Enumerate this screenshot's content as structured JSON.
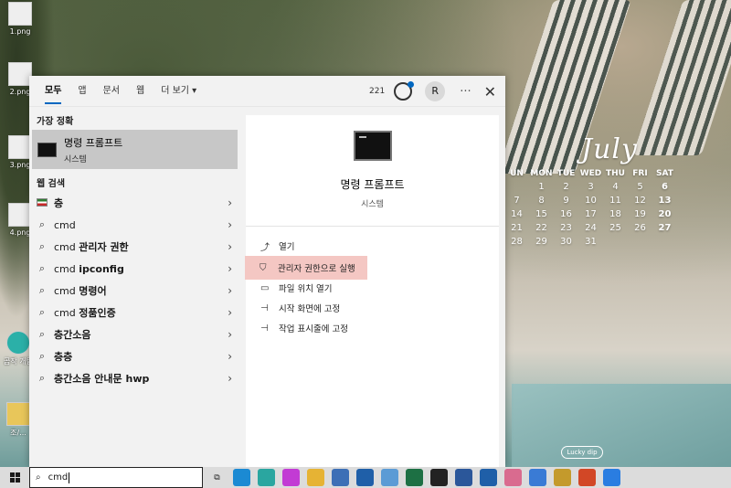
{
  "desktop": {
    "icons": [
      {
        "label": "1.png"
      },
      {
        "label": "2.png"
      },
      {
        "label": "3.png"
      },
      {
        "label": "4.png"
      },
      {
        "label": "곰작\n개팀"
      },
      {
        "label": "조/..."
      }
    ],
    "calendar": {
      "month": "July",
      "weekdays": [
        "SUN",
        "MON",
        "TUE",
        "WED",
        "THU",
        "FRI",
        "SAT"
      ],
      "days": [
        "",
        "",
        "1",
        "2",
        "3",
        "4",
        "5",
        "6",
        "7",
        "8",
        "9",
        "10",
        "11",
        "12",
        "13",
        "14",
        "15",
        "16",
        "17",
        "18",
        "19",
        "20",
        "21",
        "22",
        "23",
        "24",
        "25",
        "26",
        "27",
        "28",
        "29",
        "30",
        "31"
      ],
      "visible_weekdays": [
        "UN",
        "MON",
        "TUE",
        "WED",
        "THU",
        "FRI",
        "SAT"
      ],
      "rows": [
        [
          "",
          "1",
          "2",
          "3",
          "4",
          "5",
          "6"
        ],
        [
          "7",
          "8",
          "9",
          "10",
          "11",
          "12",
          "13"
        ],
        [
          "14",
          "15",
          "16",
          "17",
          "18",
          "19",
          "20"
        ],
        [
          "21",
          "22",
          "23",
          "24",
          "25",
          "26",
          "27"
        ],
        [
          "28",
          "29",
          "30",
          "31",
          "",
          "",
          ""
        ]
      ]
    },
    "badge": "Lucky dip"
  },
  "search": {
    "tabs": [
      {
        "label": "모두",
        "active": true
      },
      {
        "label": "앱"
      },
      {
        "label": "문서"
      },
      {
        "label": "웹"
      },
      {
        "label": "더 보기 ▾"
      }
    ],
    "points": "221",
    "avatar_initial": "R",
    "more": "···",
    "close": "✕",
    "best_match_label": "가장 정확",
    "best_match": {
      "title": "명령 프롬프트",
      "subtitle": "시스템"
    },
    "web_label": "웹 검색",
    "results": [
      {
        "pre": "",
        "bold": "층",
        "icon": "word-icon"
      },
      {
        "pre": "cmd",
        "bold": "",
        "icon": "search-icon"
      },
      {
        "pre": "cmd ",
        "bold": "관리자 권한",
        "icon": "search-icon"
      },
      {
        "pre": "cmd ",
        "bold": "ipconfig",
        "icon": "search-icon"
      },
      {
        "pre": "cmd ",
        "bold": "명령어",
        "icon": "search-icon"
      },
      {
        "pre": "cmd ",
        "bold": "정품인증",
        "icon": "search-icon"
      },
      {
        "pre": "",
        "bold": "층간소음",
        "icon": "search-icon"
      },
      {
        "pre": "",
        "bold": "층층",
        "icon": "search-icon"
      },
      {
        "pre": "",
        "bold": "층간소음 안내문 hwp",
        "icon": "search-icon"
      }
    ],
    "preview": {
      "title": "명령 프롬프트",
      "type": "시스템",
      "actions": [
        {
          "label": "열기",
          "icon": "open-icon"
        },
        {
          "label": "관리자 권한으로 실행",
          "icon": "shield-icon",
          "highlighted": true
        },
        {
          "label": "파일 위치 열기",
          "icon": "folder-icon"
        },
        {
          "label": "시작 화면에 고정",
          "icon": "pin-icon"
        },
        {
          "label": "작업 표시줄에 고정",
          "icon": "pin-icon"
        }
      ]
    }
  },
  "taskbar": {
    "search_query": "cmd",
    "apps": [
      {
        "name": "task-view-icon",
        "color": "#dcdcdc"
      },
      {
        "name": "edge-icon",
        "color": "#1b8ad3"
      },
      {
        "name": "edge-dev-icon",
        "color": "#2aa6a0"
      },
      {
        "name": "firefox-icon",
        "color": "#c23bd4"
      },
      {
        "name": "file-explorer-icon",
        "color": "#e6b334"
      },
      {
        "name": "calculator-icon",
        "color": "#3d6fb6"
      },
      {
        "name": "app-icon",
        "color": "#1f5fa8"
      },
      {
        "name": "remote-icon",
        "color": "#5b9bd5"
      },
      {
        "name": "excel-icon",
        "color": "#1d7044"
      },
      {
        "name": "camera-icon",
        "color": "#222222"
      },
      {
        "name": "word-icon",
        "color": "#2b579a"
      },
      {
        "name": "app2-icon",
        "color": "#1f5fa8"
      },
      {
        "name": "paint-icon",
        "color": "#d96b8f"
      },
      {
        "name": "store-icon",
        "color": "#3a7bd5"
      },
      {
        "name": "game-icon",
        "color": "#c49a2c"
      },
      {
        "name": "slides-icon",
        "color": "#d24726"
      },
      {
        "name": "nav-icon",
        "color": "#2a7de1"
      }
    ]
  }
}
